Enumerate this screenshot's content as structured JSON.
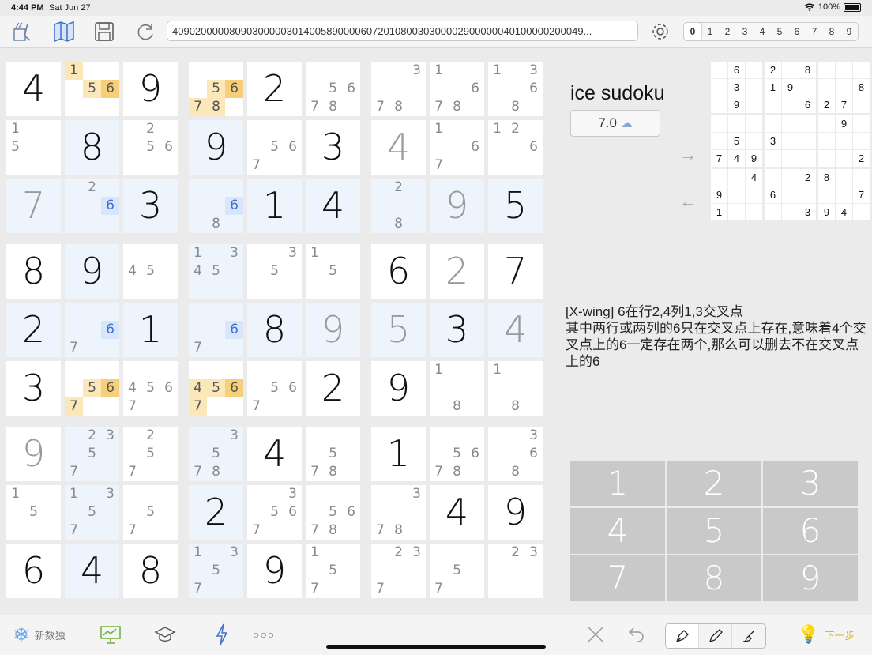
{
  "status": {
    "time": "4:44 PM",
    "date": "Sat Jun 27",
    "battery": "100%"
  },
  "toolbar": {
    "puzzle_code": "409020000080903000003014005890000607201080030300002900000040100000200049...",
    "digit_filters": [
      "0",
      "1",
      "2",
      "3",
      "4",
      "5",
      "6",
      "7",
      "8",
      "9"
    ],
    "selected_filter": "0"
  },
  "board": {
    "rows": [
      [
        {
          "v": "4"
        },
        {
          "c": [
            "1",
            "",
            "",
            "",
            "5",
            "6"
          ],
          "hl": {
            "5": "y",
            "6": "yo",
            "1": "y"
          },
          "bg": "y"
        },
        {
          "v": "9"
        },
        {
          "c": [
            "",
            "",
            "",
            "",
            "5",
            "6",
            "7",
            "8",
            ""
          ],
          "hl": {
            "5": "y",
            "6": "yo",
            "7": "y",
            "8": "y"
          },
          "bg": "y"
        },
        {
          "v": "2"
        },
        {
          "c": [
            "",
            "",
            "",
            "",
            "5",
            "6",
            "7",
            "8",
            ""
          ]
        },
        {
          "c": [
            "",
            "",
            "3",
            "",
            "",
            "",
            "7",
            "8",
            ""
          ]
        },
        {
          "c": [
            "1",
            "",
            "",
            "",
            "",
            "6",
            "7",
            "8",
            ""
          ]
        },
        {
          "c": [
            "1",
            "",
            "3",
            "",
            "",
            "6",
            "",
            "8",
            ""
          ]
        }
      ],
      [
        {
          "c": [
            "1",
            "",
            "",
            "5",
            "",
            "",
            "",
            "",
            ""
          ]
        },
        {
          "v": "8",
          "blue": true
        },
        {
          "c": [
            "",
            "2",
            "",
            "",
            "5",
            "6",
            "",
            "",
            ""
          ]
        },
        {
          "v": "9",
          "blue": true
        },
        {
          "c": [
            "",
            "",
            "",
            "",
            "5",
            "6",
            "7",
            "",
            ""
          ]
        },
        {
          "v": "3"
        },
        {
          "v": "4",
          "gray": true
        },
        {
          "c": [
            "1",
            "",
            "",
            "",
            "",
            "6",
            "7",
            "",
            ""
          ]
        },
        {
          "c": [
            "1",
            "2",
            "",
            "",
            "",
            "6",
            "",
            "",
            ""
          ]
        }
      ],
      [
        {
          "v": "7",
          "gray": true,
          "blue": true
        },
        {
          "c": [
            "",
            "2",
            "",
            "",
            "",
            "6",
            "",
            "",
            ""
          ],
          "hl": {
            "6": "b"
          },
          "blue": true
        },
        {
          "v": "3",
          "blue": true
        },
        {
          "c": [
            "",
            "",
            "",
            "",
            "",
            "6",
            "",
            "8",
            ""
          ],
          "hl": {
            "6": "b"
          },
          "blue": true
        },
        {
          "v": "1",
          "blue": true
        },
        {
          "v": "4",
          "blue": true
        },
        {
          "c": [
            "",
            "2",
            "",
            "",
            "",
            "",
            "",
            "8",
            ""
          ],
          "blue": true
        },
        {
          "v": "9",
          "gray": true,
          "blue": true
        },
        {
          "v": "5",
          "blue": true
        }
      ],
      [
        {
          "v": "8"
        },
        {
          "v": "9",
          "blue": true
        },
        {
          "c": [
            "",
            "",
            "",
            "4",
            "5",
            "",
            "",
            "",
            ""
          ]
        },
        {
          "c": [
            "1",
            "",
            "3",
            "4",
            "5",
            "",
            "",
            "",
            ""
          ],
          "blue": true
        },
        {
          "c": [
            "",
            "",
            "3",
            "",
            "5",
            "",
            "",
            "",
            ""
          ]
        },
        {
          "c": [
            "1",
            "",
            "",
            "",
            "5",
            "",
            "",
            "",
            ""
          ]
        },
        {
          "v": "6"
        },
        {
          "v": "2",
          "gray": true
        },
        {
          "v": "7"
        }
      ],
      [
        {
          "v": "2",
          "blue": true
        },
        {
          "c": [
            "",
            "",
            "",
            "",
            "",
            "6",
            "7",
            "",
            ""
          ],
          "hl": {
            "6": "b"
          },
          "blue": true
        },
        {
          "v": "1",
          "blue": true
        },
        {
          "c": [
            "",
            "",
            "",
            "",
            "",
            "6",
            "7",
            "",
            ""
          ],
          "hl": {
            "6": "b"
          },
          "blue": true
        },
        {
          "v": "8",
          "blue": true
        },
        {
          "v": "9",
          "gray": true,
          "blue": true
        },
        {
          "v": "5",
          "gray": true,
          "blue": true
        },
        {
          "v": "3",
          "blue": true
        },
        {
          "v": "4",
          "gray": true,
          "blue": true
        }
      ],
      [
        {
          "v": "3"
        },
        {
          "c": [
            "",
            "",
            "",
            "",
            "5",
            "6",
            "7",
            "",
            ""
          ],
          "hl": {
            "5": "y",
            "6": "yo",
            "7": "y"
          },
          "bg": "y"
        },
        {
          "c": [
            "",
            "",
            "",
            "4",
            "5",
            "6",
            "7",
            "",
            ""
          ]
        },
        {
          "c": [
            "",
            "",
            "",
            "4",
            "5",
            "6",
            "7",
            "",
            ""
          ],
          "hl": {
            "4": "y",
            "5": "y",
            "6": "yo",
            "7": "y"
          },
          "bg": "y"
        },
        {
          "c": [
            "",
            "",
            "",
            "",
            "5",
            "6",
            "7",
            "",
            ""
          ]
        },
        {
          "v": "2"
        },
        {
          "v": "9"
        },
        {
          "c": [
            "1",
            "",
            "",
            "",
            "",
            "",
            "",
            "8",
            ""
          ]
        },
        {
          "c": [
            "1",
            "",
            "",
            "",
            "",
            "",
            "",
            "8",
            ""
          ]
        }
      ],
      [
        {
          "v": "9",
          "gray": true
        },
        {
          "c": [
            "",
            "2",
            "3",
            "",
            "5",
            "",
            "7",
            "",
            ""
          ],
          "blue": true
        },
        {
          "c": [
            "",
            "2",
            "",
            "",
            "5",
            "",
            "7",
            "",
            ""
          ]
        },
        {
          "c": [
            "",
            "",
            "3",
            "",
            "5",
            "",
            "7",
            "8",
            ""
          ],
          "blue": true
        },
        {
          "v": "4"
        },
        {
          "c": [
            "",
            "",
            "",
            "",
            "5",
            "",
            "7",
            "8",
            ""
          ]
        },
        {
          "v": "1"
        },
        {
          "c": [
            "",
            "",
            "",
            "",
            "5",
            "6",
            "7",
            "8",
            ""
          ]
        },
        {
          "c": [
            "",
            "",
            "3",
            "",
            "",
            "6",
            "",
            "8",
            ""
          ]
        }
      ],
      [
        {
          "c": [
            "1",
            "",
            "",
            "",
            "5",
            "",
            "",
            "",
            ""
          ]
        },
        {
          "c": [
            "1",
            "",
            "3",
            "",
            "5",
            "",
            "7",
            "",
            ""
          ],
          "blue": true
        },
        {
          "c": [
            "",
            "",
            "",
            "",
            "5",
            "",
            "7",
            "",
            ""
          ]
        },
        {
          "v": "2",
          "blue": true
        },
        {
          "c": [
            "",
            "",
            "3",
            "",
            "5",
            "6",
            "7",
            "",
            ""
          ]
        },
        {
          "c": [
            "",
            "",
            "",
            "",
            "5",
            "6",
            "7",
            "8",
            ""
          ]
        },
        {
          "c": [
            "",
            "",
            "3",
            "",
            "",
            "",
            "7",
            "8",
            ""
          ]
        },
        {
          "v": "4"
        },
        {
          "v": "9"
        }
      ],
      [
        {
          "v": "6"
        },
        {
          "v": "4",
          "blue": true
        },
        {
          "v": "8"
        },
        {
          "c": [
            "1",
            "",
            "3",
            "",
            "5",
            "",
            "7",
            "",
            ""
          ],
          "blue": true
        },
        {
          "v": "9"
        },
        {
          "c": [
            "1",
            "",
            "",
            "",
            "5",
            "",
            "7",
            "",
            ""
          ]
        },
        {
          "c": [
            "",
            "2",
            "3",
            "",
            "",
            "",
            "7",
            "",
            ""
          ]
        },
        {
          "c": [
            "",
            "",
            "",
            "",
            "5",
            "",
            "7",
            "",
            ""
          ]
        },
        {
          "c": [
            "",
            "2",
            "3",
            "",
            "",
            "",
            "",
            "",
            ""
          ]
        }
      ]
    ]
  },
  "app_title": "ice sudoku",
  "difficulty": "7.0",
  "mini_grid": [
    [
      "",
      "6",
      "",
      "2",
      "",
      "8",
      "",
      "",
      ""
    ],
    [
      "",
      "3",
      "",
      "1",
      "9",
      "",
      "",
      "",
      "8"
    ],
    [
      "",
      "9",
      "",
      "",
      "",
      "6",
      "2",
      "7",
      ""
    ],
    [
      "",
      "",
      "",
      "",
      "",
      "",
      "",
      "9",
      ""
    ],
    [
      "",
      "5",
      "",
      "3",
      "",
      "",
      "",
      "",
      ""
    ],
    [
      "7",
      "4",
      "9",
      "",
      "",
      "",
      "",
      "",
      "2"
    ],
    [
      "",
      "",
      "4",
      "",
      "",
      "2",
      "8",
      "",
      ""
    ],
    [
      "9",
      "",
      "",
      "6",
      "",
      "",
      "",
      "",
      "7"
    ],
    [
      "1",
      "",
      "",
      "",
      "",
      "3",
      "9",
      "4",
      ""
    ]
  ],
  "hint_text": "[X-wing] 6在行2,4列1,3交叉点\n其中两行或两列的6只在交叉点上存在,意味着4个交叉点上的6一定存在两个,那么可以删去不在交叉点上的6",
  "keypad": [
    "1",
    "2",
    "3",
    "4",
    "5",
    "6",
    "7",
    "8",
    "9"
  ],
  "bottom": {
    "new_label": "新数独",
    "next_label": "下一步"
  },
  "colors": {
    "accent_yellow": "#fbe7b8",
    "accent_orange": "#f7cf78",
    "accent_blue": "#eef4fc",
    "keypad": "#c9c9c9"
  }
}
